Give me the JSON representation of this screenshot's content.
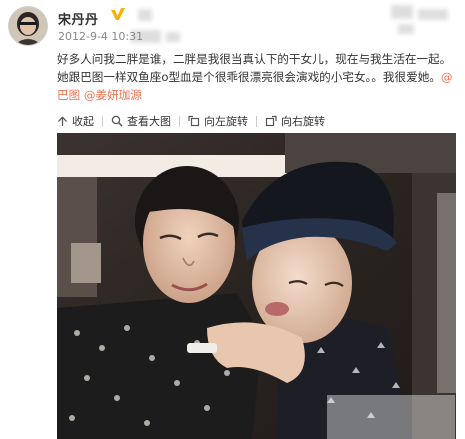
{
  "post": {
    "author": {
      "name": "宋丹丹",
      "avatar_icon": "avatar-photo",
      "verified_icon": "verified-badge-icon"
    },
    "timestamp": "2012-9-4 10:31",
    "text": "好多人问我二胖是谁，二胖是我很当真认下的干女儿，现在与我生活在一起。她跟巴图一样双鱼座o型血是个很乖很漂亮很会演戏的小宅女。。我很爱她。",
    "mentions": [
      "@巴图",
      "@姜妍珈源"
    ],
    "toolbar": {
      "collapse": "收起",
      "view_large": "查看大图",
      "rotate_left": "向左旋转",
      "rotate_right": "向右旋转"
    },
    "colors": {
      "mention": "#eb7350",
      "text": "#333333",
      "timestamp": "#888888",
      "verified": "#f5b30a"
    }
  }
}
